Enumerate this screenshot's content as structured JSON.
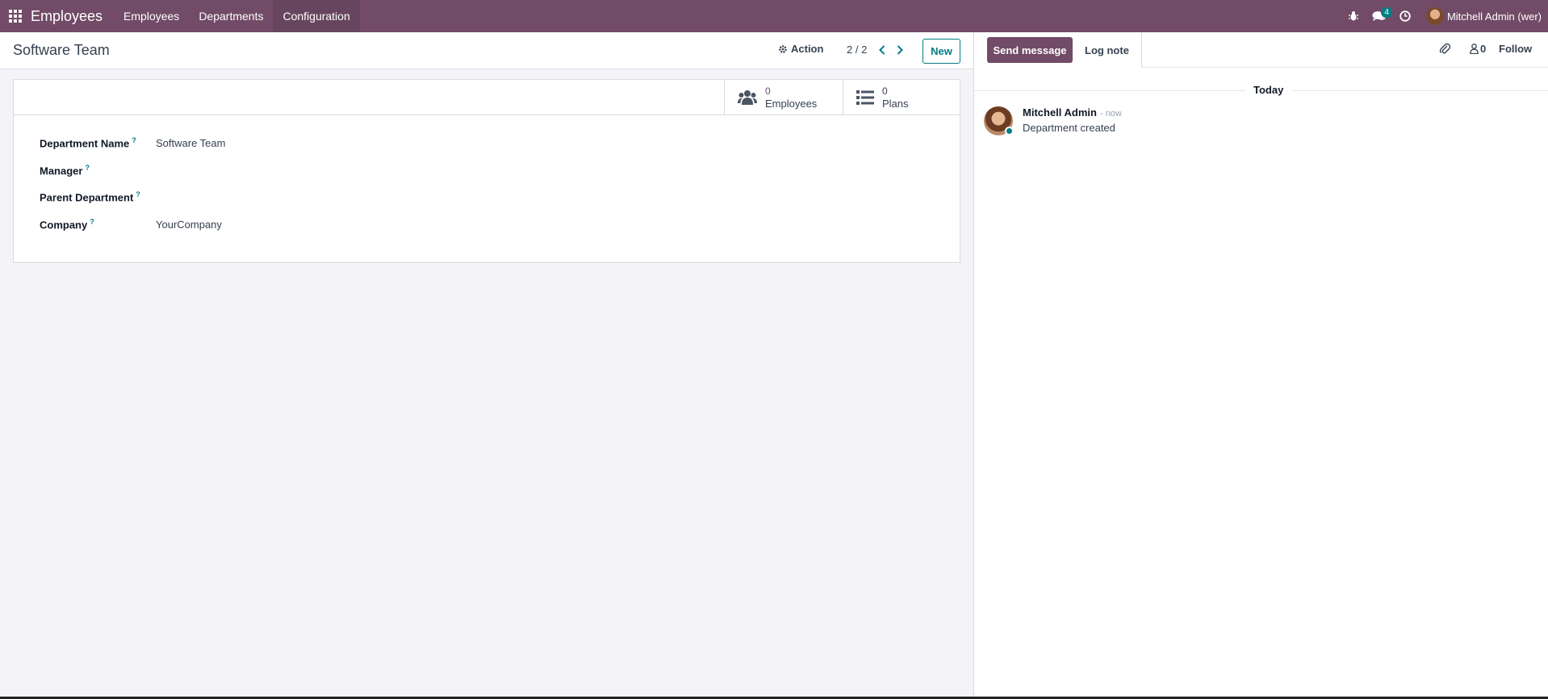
{
  "navbar": {
    "app_name": "Employees",
    "menu": [
      "Employees",
      "Departments",
      "Configuration"
    ],
    "messages_badge": "4",
    "user_name": "Mitchell Admin (wer)"
  },
  "control_panel": {
    "breadcrumb": "Software Team",
    "action_label": "Action",
    "pager": "2 / 2",
    "new_label": "New"
  },
  "form": {
    "stat_buttons": [
      {
        "value": "0",
        "label": "Employees",
        "icon": "users-icon"
      },
      {
        "value": "0",
        "label": "Plans",
        "icon": "list-icon"
      }
    ],
    "help_mark": "?",
    "fields": [
      {
        "label": "Department Name",
        "value": "Software Team"
      },
      {
        "label": "Manager",
        "value": ""
      },
      {
        "label": "Parent Department",
        "value": ""
      },
      {
        "label": "Company",
        "value": "YourCompany"
      }
    ]
  },
  "chatter": {
    "send_message": "Send message",
    "log_note": "Log note",
    "followers_count": "0",
    "follow": "Follow",
    "date_separator": "Today",
    "messages": [
      {
        "author": "Mitchell Admin",
        "time": "- now",
        "text": "Department created"
      }
    ]
  },
  "colors": {
    "brand": "#714B67",
    "accent": "#017e84"
  }
}
